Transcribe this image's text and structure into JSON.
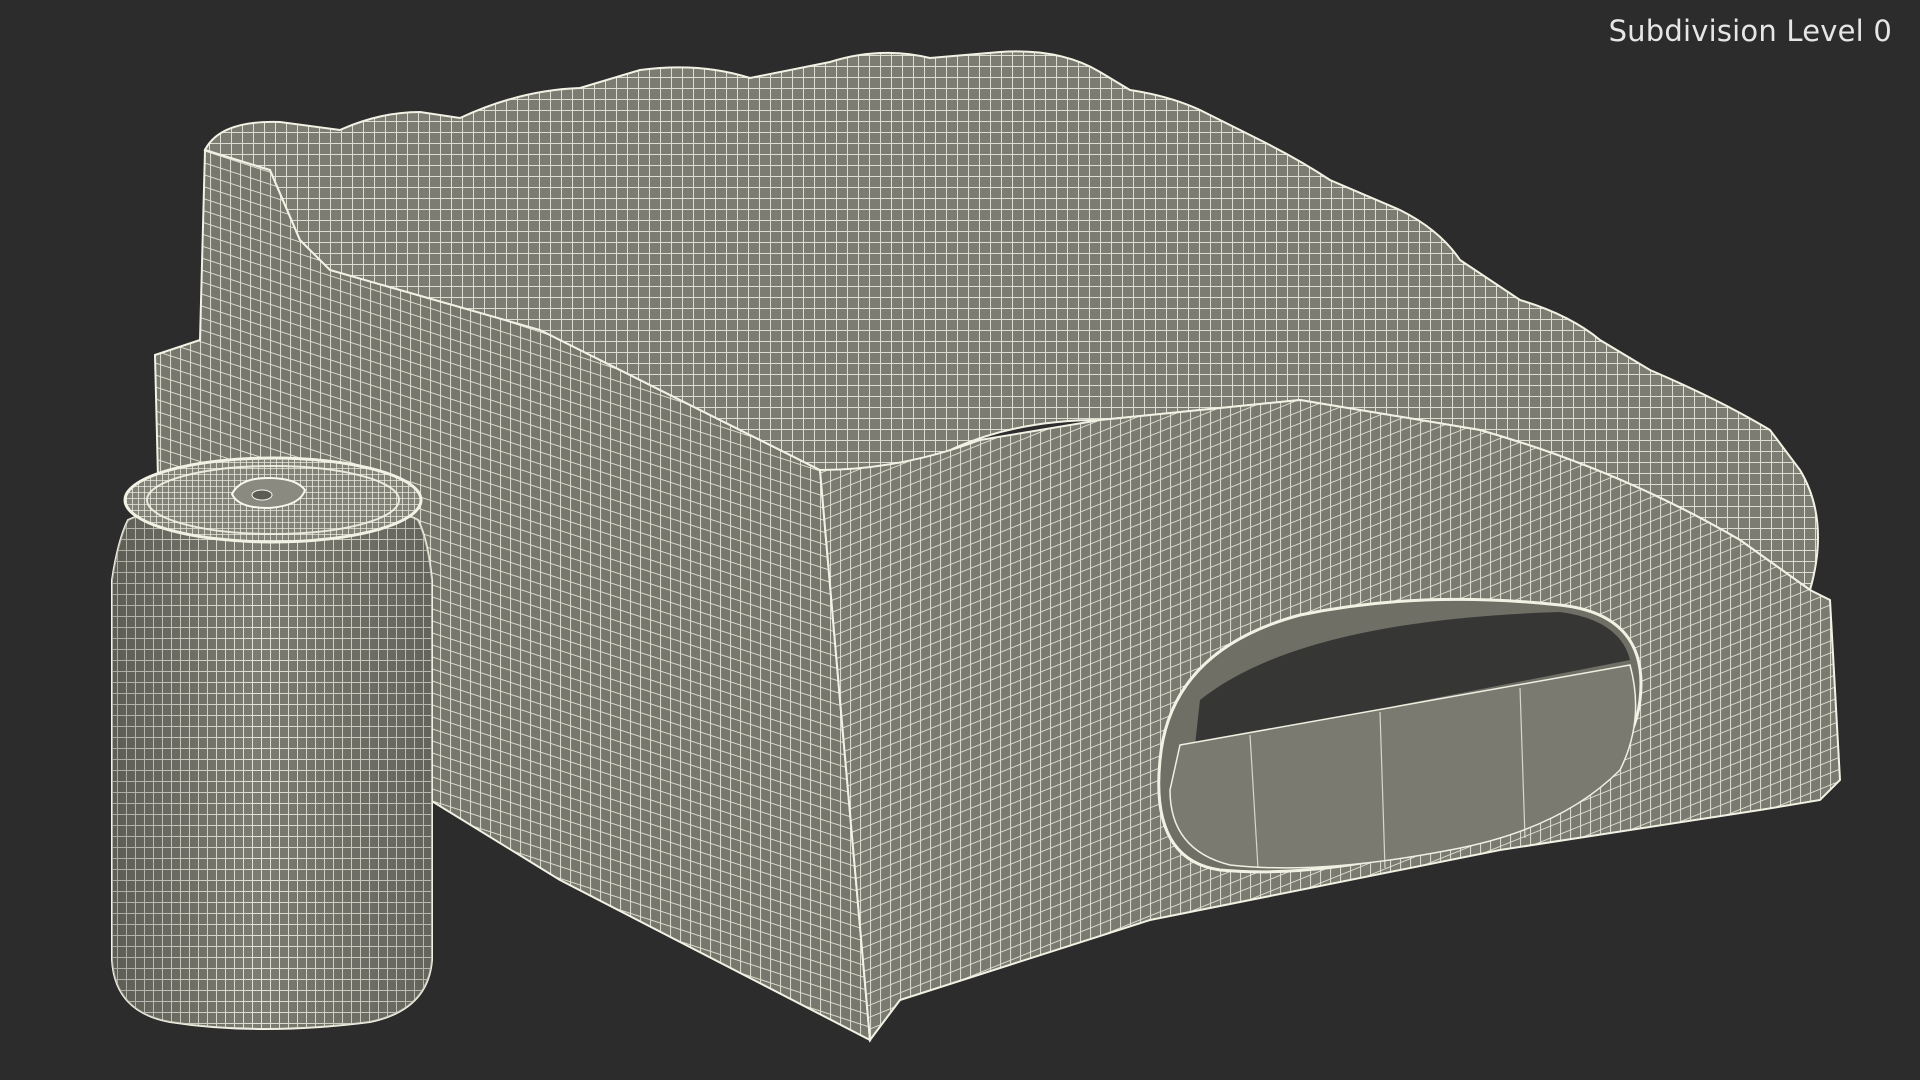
{
  "viewport": {
    "background": "#2c2c2c",
    "label": "Subdivision Level 0"
  },
  "model": {
    "objects": [
      "shrink-wrapped-can-pack",
      "beverage-can"
    ],
    "surface_color": "#7c7c72",
    "wire_color": "#f2f2e4"
  }
}
